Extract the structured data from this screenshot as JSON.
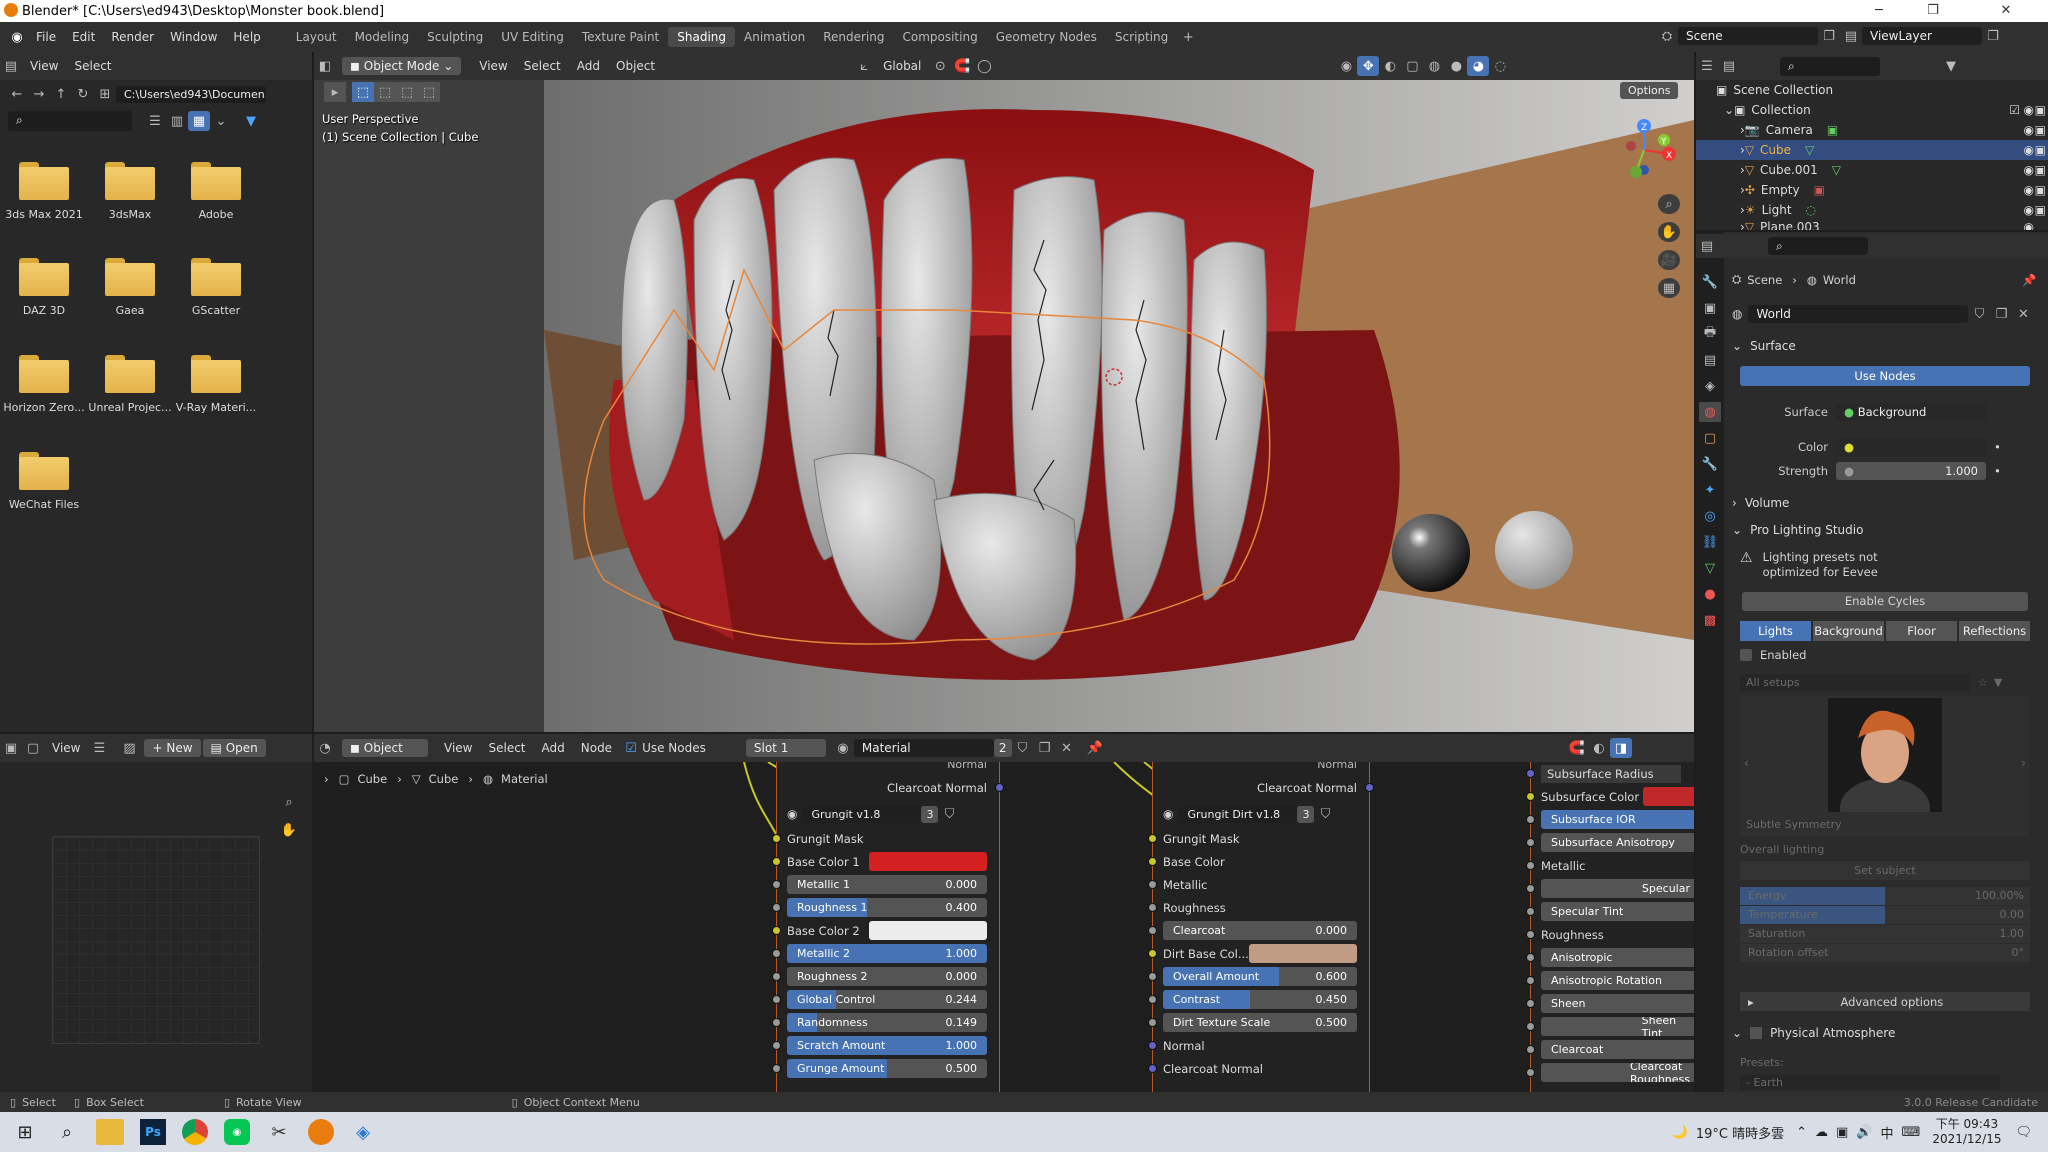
{
  "window": {
    "title": "Blender* [C:\\Users\\ed943\\Desktop\\Monster book.blend]",
    "minimize": "─",
    "maximize": "❐",
    "close": "✕"
  },
  "menus": [
    "File",
    "Edit",
    "Render",
    "Window",
    "Help"
  ],
  "workspaces": [
    "Layout",
    "Modeling",
    "Sculpting",
    "UV Editing",
    "Texture Paint",
    "Shading",
    "Animation",
    "Rendering",
    "Compositing",
    "Geometry Nodes",
    "Scripting"
  ],
  "active_workspace": "Shading",
  "scene": {
    "name": "Scene",
    "view_layer": "ViewLayer"
  },
  "file_browser": {
    "menus": [
      "View",
      "Select"
    ],
    "path": "C:\\Users\\ed943\\Documen...",
    "items": [
      "3ds Max 2021",
      "3dsMax",
      "Adobe",
      "DAZ 3D",
      "Gaea",
      "GScatter",
      "Horizon Zero...",
      "Unreal Projec...",
      "V-Ray Materi...",
      "WeChat Files"
    ]
  },
  "viewport": {
    "mode": "Object Mode",
    "menus": [
      "View",
      "Select",
      "Add",
      "Object"
    ],
    "transform": "Global",
    "options": "Options",
    "info1": "User Perspective",
    "info2": "(1) Scene Collection | Cube",
    "axis_x": "X",
    "axis_y": "Y",
    "axis_z": "Z"
  },
  "image_editor": {
    "view": "View",
    "new": "New",
    "open": "Open"
  },
  "node_editor": {
    "type": "Object",
    "menus": [
      "View",
      "Select",
      "Add",
      "Node"
    ],
    "use_nodes": "Use Nodes",
    "slot": "Slot 1",
    "material": "Material",
    "users": "2",
    "breadcrumb": [
      "Cube",
      "Cube",
      "Material"
    ]
  },
  "node1": {
    "top_normal": "Normal",
    "clearcoat_normal": "Clearcoat Normal",
    "group": "Grungit v1.8",
    "count": "3",
    "grunge_mask": "Grungit Mask",
    "base_color1": "Base Color 1",
    "base_color2": "Base Color 2",
    "fields": [
      {
        "label": "Metallic 1",
        "value": "0.000",
        "fill": 0
      },
      {
        "label": "Roughness 1",
        "value": "0.400",
        "fill": 0.4
      },
      {
        "label": "Metallic 2",
        "value": "1.000",
        "fill": 1
      },
      {
        "label": "Roughness 2",
        "value": "0.000",
        "fill": 0
      },
      {
        "label": "Global Control",
        "value": "0.244",
        "fill": 0.244
      },
      {
        "label": "Randomness",
        "value": "0.149",
        "fill": 0.149
      },
      {
        "label": "Scratch Amount",
        "value": "1.000",
        "fill": 1
      },
      {
        "label": "Grunge Amount",
        "value": "0.500",
        "fill": 0.5
      }
    ],
    "color1": "#d42020",
    "color2": "#ececec"
  },
  "node2": {
    "top_normal": "Normal",
    "clearcoat_normal": "Clearcoat Normal",
    "group": "Grungit Dirt v1.8",
    "count": "3",
    "grunge_mask": "Grungit Mask",
    "base_color": "Base Color",
    "metallic": "Metallic",
    "roughness": "Roughness",
    "clearcoat": {
      "label": "Clearcoat",
      "value": "0.000",
      "fill": 0
    },
    "dirt_base": "Dirt Base Col...",
    "dirt_color": "#c09c84",
    "fields": [
      {
        "label": "Overall Amount",
        "value": "0.600",
        "fill": 0.6
      },
      {
        "label": "Contrast",
        "value": "0.450",
        "fill": 0.45
      },
      {
        "label": "Dirt Texture Scale",
        "value": "0.500",
        "fill": 0
      }
    ],
    "normal": "Normal",
    "clearcoat_normal2": "Clearcoat Normal"
  },
  "node3": {
    "rows": [
      "Subsurface Radius",
      "Subsurface Color",
      "Subsurface IOR",
      "Subsurface Anisotropy",
      "Metallic",
      "Specular",
      "Specular Tint",
      "Roughness",
      "Anisotropic",
      "Anisotropic Rotation",
      "Sheen",
      "Sheen Tint",
      "Clearcoat",
      "Clearcoat Roughness"
    ],
    "subsurface_color": "#c0282a"
  },
  "outliner": {
    "root": "Scene Collection",
    "collection": "Collection",
    "items": [
      "Camera",
      "Cube",
      "Cube.001",
      "Empty",
      "Light",
      "Plane.003"
    ],
    "selected": "Cube"
  },
  "properties": {
    "breadcrumb": [
      "Scene",
      "World"
    ],
    "world": "World",
    "surface_header": "Surface",
    "use_nodes": "Use Nodes",
    "surface_label": "Surface",
    "surface_value": "Background",
    "color_label": "Color",
    "strength_label": "Strength",
    "strength_value": "1.000",
    "volume": "Volume",
    "pls": "Pro Lighting Studio",
    "warning": "Lighting presets not optimized for Eevee",
    "enable_cycles": "Enable Cycles",
    "tabs": [
      "Lights",
      "Background",
      "Floor",
      "Reflections"
    ],
    "enabled": "Enabled",
    "all_setups": "All setups",
    "preview_caption": "Subtle Symmetry",
    "overall_lighting": "Overall lighting",
    "set_subject": "Set subject",
    "sliders": [
      {
        "label": "Energy",
        "value": "100.00%"
      },
      {
        "label": "Temperature",
        "value": "0.00"
      },
      {
        "label": "Saturation",
        "value": "1.00"
      },
      {
        "label": "Rotation offset",
        "value": "0°"
      }
    ],
    "advanced": "Advanced options",
    "physical_atmosphere": "Physical Atmosphere",
    "presets": "Presets:",
    "earth": "- Earth"
  },
  "statusbar": {
    "select": "Select",
    "box_select": "Box Select",
    "rotate_view": "Rotate View",
    "context_menu": "Object Context Menu",
    "version": "3.0.0 Release Candidate"
  },
  "taskbar": {
    "weather": "19°C 晴時多雲",
    "ime": "中",
    "time": "下午 09:43",
    "date": "2021/12/15"
  }
}
